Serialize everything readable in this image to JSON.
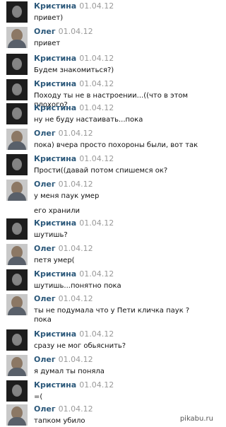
{
  "messages": [
    {
      "author": "Кристина",
      "date": "01.04.12",
      "text": "привет)"
    },
    {
      "author": "Олег",
      "date": "01.04.12",
      "text": "привет"
    },
    {
      "author": "Кристина",
      "date": "01.04.12",
      "text": "Будем знакомиться?)"
    },
    {
      "author": "Кристина",
      "date": "01.04.12",
      "text": "Походу ты не в настроении...((что в этом плохого?"
    },
    {
      "author": "Кристина",
      "date": "01.04.12",
      "text": "ну не буду настаивать...пока"
    },
    {
      "author": "Олег",
      "date": "01.04.12",
      "text": "пока) вчера просто похороны были, вот так"
    },
    {
      "author": "Кристина",
      "date": "01.04.12",
      "text": "Прости((давай потом спишемся ок?"
    },
    {
      "author": "Олег",
      "date": "01.04.12",
      "text": "у меня паук умер",
      "extra": "его хранили"
    },
    {
      "author": "Кристина",
      "date": "01.04.12",
      "text": "шутишь?"
    },
    {
      "author": "Олег",
      "date": "01.04.12",
      "text": "петя умер("
    },
    {
      "author": "Кристина",
      "date": "01.04.12",
      "text": "шутишь...понятно пока"
    },
    {
      "author": "Олег",
      "date": "01.04.12",
      "text": "ты не подумала что у Пети кличка паук ?\nпока"
    },
    {
      "author": "Кристина",
      "date": "01.04.12",
      "text": "сразу не мог обьяснить?"
    },
    {
      "author": "Олег",
      "date": "01.04.12",
      "text": "я думал ты поняла"
    },
    {
      "author": "Кристина",
      "date": "01.04.12",
      "text": "=("
    },
    {
      "author": "Олег",
      "date": "01.04.12",
      "text": "тапком убило"
    }
  ],
  "watermark": "pikabu.ru"
}
